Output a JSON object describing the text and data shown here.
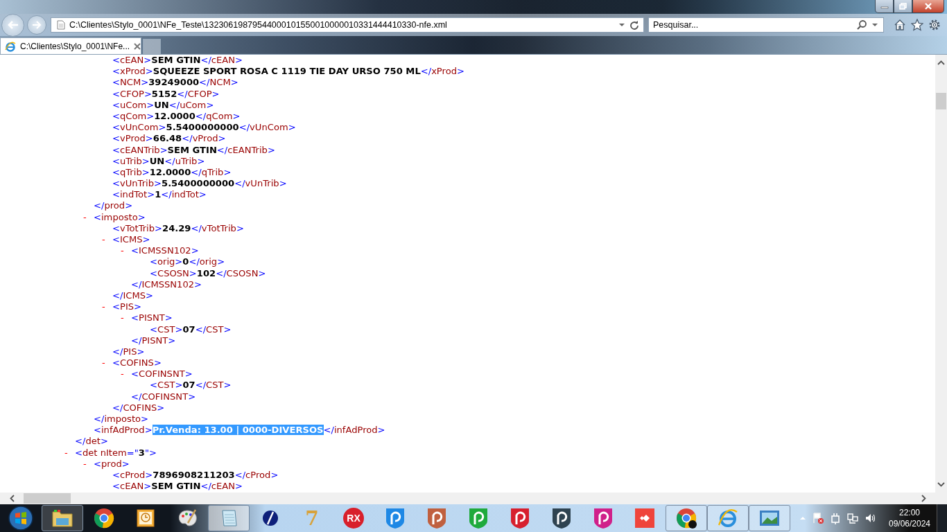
{
  "browser": {
    "address": "C:\\Clientes\\Stylo_0001\\NFe_Teste\\13230619879544000101550010000010331444410330-nfe.xml",
    "search": {
      "placeholder": "Pesquisar..."
    },
    "tabs": [
      {
        "label": "C:\\Clientes\\Stylo_0001\\NFe...",
        "selected": true
      }
    ]
  },
  "xml": [
    {
      "close_tag": "</det>",
      "children": [
        {
          "close_tag": "</prod>",
          "children": [
            {
              "open_tag": "<cEAN>",
              "value": "SEM GTIN",
              "close_tag": "</cEAN>",
              "selected": false
            },
            {
              "open_tag": "<xProd>",
              "value": "SQUEEZE SPORT ROSA C 1119 TIE DAY URSO 750 ML",
              "close_tag": "</xProd>",
              "selected": false
            },
            {
              "open_tag": "<NCM>",
              "value": "39249000",
              "close_tag": "</NCM>",
              "selected": false
            },
            {
              "open_tag": "<CFOP>",
              "value": "5152",
              "close_tag": "</CFOP>",
              "selected": false
            },
            {
              "open_tag": "<uCom>",
              "value": "UN",
              "close_tag": "</uCom>",
              "selected": false
            },
            {
              "open_tag": "<qCom>",
              "value": "12.0000",
              "close_tag": "</qCom>",
              "selected": false
            },
            {
              "open_tag": "<vUnCom>",
              "value": "5.5400000000",
              "close_tag": "</vUnCom>",
              "selected": false
            },
            {
              "open_tag": "<vProd>",
              "value": "66.48",
              "close_tag": "</vProd>",
              "selected": false
            },
            {
              "open_tag": "<cEANTrib>",
              "value": "SEM GTIN",
              "close_tag": "</cEANTrib>",
              "selected": false
            },
            {
              "open_tag": "<uTrib>",
              "value": "UN",
              "close_tag": "</uTrib>",
              "selected": false
            },
            {
              "open_tag": "<qTrib>",
              "value": "12.0000",
              "close_tag": "</qTrib>",
              "selected": false
            },
            {
              "open_tag": "<vUnTrib>",
              "value": "5.5400000000",
              "close_tag": "</vUnTrib>",
              "selected": false
            },
            {
              "open_tag": "<indTot>",
              "value": "1",
              "close_tag": "</indTot>",
              "selected": false
            }
          ]
        },
        {
          "toggle": "-",
          "expanded": true,
          "open_tag": "<imposto>",
          "close_tag": "</imposto>",
          "children": [
            {
              "open_tag": "<vTotTrib>",
              "value": "24.29",
              "close_tag": "</vTotTrib>",
              "selected": false
            },
            {
              "toggle": "-",
              "expanded": true,
              "open_tag": "<ICMS>",
              "close_tag": "</ICMS>",
              "children": [
                {
                  "toggle": "-",
                  "expanded": true,
                  "open_tag": "<ICMSSN102>",
                  "close_tag": "</ICMSSN102>",
                  "children": [
                    {
                      "open_tag": "<orig>",
                      "value": "0",
                      "close_tag": "</orig>",
                      "selected": false
                    },
                    {
                      "open_tag": "<CSOSN>",
                      "value": "102",
                      "close_tag": "</CSOSN>",
                      "selected": false
                    }
                  ]
                }
              ]
            },
            {
              "toggle": "-",
              "expanded": true,
              "open_tag": "<PIS>",
              "close_tag": "</PIS>",
              "children": [
                {
                  "toggle": "-",
                  "expanded": true,
                  "open_tag": "<PISNT>",
                  "close_tag": "</PISNT>",
                  "children": [
                    {
                      "open_tag": "<CST>",
                      "value": "07",
                      "close_tag": "</CST>",
                      "selected": false
                    }
                  ]
                }
              ]
            },
            {
              "toggle": "-",
              "expanded": true,
              "open_tag": "<COFINS>",
              "close_tag": "</COFINS>",
              "children": [
                {
                  "toggle": "-",
                  "expanded": true,
                  "open_tag": "<COFINSNT>",
                  "close_tag": "</COFINSNT>",
                  "children": [
                    {
                      "open_tag": "<CST>",
                      "value": "07",
                      "close_tag": "</CST>",
                      "selected": false
                    }
                  ]
                }
              ]
            }
          ]
        },
        {
          "open_tag": "<infAdProd>",
          "value": "Pr.Venda: 13.00 | 0000-DIVERSOS",
          "close_tag": "</infAdProd>",
          "selected": true
        }
      ]
    },
    {
      "toggle": "-",
      "expanded": true,
      "open_tag": "<det nItem=\"3\">",
      "children": [
        {
          "toggle": "-",
          "expanded": true,
          "open_tag": "<prod>",
          "children": [
            {
              "open_tag": "<cProd>",
              "value": "7896908211203",
              "close_tag": "</cProd>",
              "selected": false
            },
            {
              "open_tag": "<cEAN>",
              "value": "SEM GTIN",
              "close_tag": "</cEAN>",
              "selected": false
            }
          ]
        }
      ]
    }
  ],
  "taskbar": {
    "apps": [
      {
        "kind": "explorer",
        "running": true,
        "selected": false
      },
      {
        "kind": "chrome",
        "running": false,
        "selected": false
      },
      {
        "kind": "outlook",
        "running": false,
        "selected": false
      },
      {
        "kind": "paint",
        "running": false,
        "selected": false
      },
      {
        "kind": "notepad",
        "running": true,
        "selected": true
      },
      {
        "kind": "slash",
        "running": false,
        "selected": false
      },
      {
        "kind": "seven",
        "label": "7",
        "running": false,
        "selected": false
      },
      {
        "kind": "rx",
        "label": "RX",
        "running": false,
        "selected": false
      },
      {
        "kind": "shield",
        "color": "#1e88e5",
        "running": false,
        "selected": false
      },
      {
        "kind": "shield",
        "color": "#c0603f",
        "running": false,
        "selected": false
      },
      {
        "kind": "shield",
        "color": "#1faa3c",
        "running": false,
        "selected": false
      },
      {
        "kind": "shield",
        "color": "#d7202e",
        "running": false,
        "selected": false
      },
      {
        "kind": "shield",
        "color": "#2f4350",
        "running": false,
        "selected": false
      },
      {
        "kind": "shield",
        "color": "#d0208a",
        "running": false,
        "selected": false
      },
      {
        "kind": "diamond",
        "running": false,
        "selected": false
      },
      {
        "kind": "chrome",
        "running": true,
        "selected": false
      },
      {
        "kind": "ie",
        "running": true,
        "selected": false
      },
      {
        "kind": "photos",
        "running": true,
        "selected": false
      }
    ],
    "clock": {
      "time": "22:00",
      "date": "09/06/2024"
    }
  }
}
